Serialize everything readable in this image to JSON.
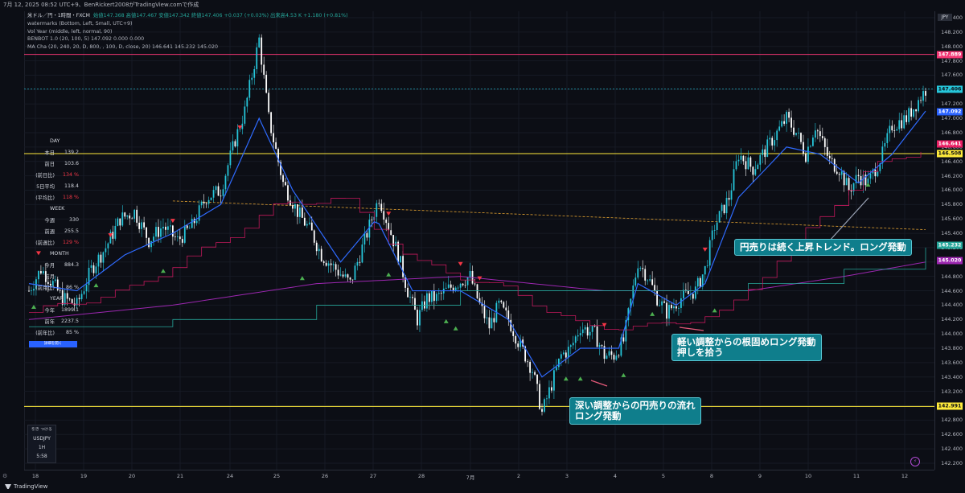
{
  "topbar": {
    "text": "7月 12, 2025 08:52 UTC+9、BenRickert2008がTradingView.comで作成"
  },
  "legend": {
    "symbol": "米ドル／円・1時間・FXCM",
    "ohlc": "始値147.368  高値147.467  安値147.342  終値147.406  +0.037 (+0.03%)  出来高4.53 K  +1.180 (+0.81%)",
    "lines": [
      "watermarks (Bottom, Left, Small, UTC+9)",
      "Vol Year (middle, left, normal, 90)",
      "BENBOT 1.0 (20, 100, 5)  147.092  0.000  0.000",
      "MA Cha (20, 240, 20, D, 800, , 100, D, close, 20)  146.641  145.232  145.020"
    ]
  },
  "stats": {
    "day_header": "DAY",
    "day": [
      {
        "label": "本日",
        "value": "139.2",
        "red": false
      },
      {
        "label": "前日",
        "value": "103.6",
        "red": false
      },
      {
        "label": "(前日比)",
        "value": "134 %",
        "red": true
      },
      {
        "label": "5日平均",
        "value": "118.4",
        "red": false
      },
      {
        "label": "(平均比)",
        "value": "118 %",
        "red": true
      }
    ],
    "week_header": "WEEK",
    "week": [
      {
        "label": "今週",
        "value": "330",
        "red": false
      },
      {
        "label": "前週",
        "value": "255.5",
        "red": false
      },
      {
        "label": "(前週比)",
        "value": "129 %",
        "red": true
      }
    ],
    "month_header": "MONTH",
    "month": [
      {
        "label": "今月",
        "value": "884.3",
        "red": false
      },
      {
        "label": "前月",
        "value": "",
        "red": false
      },
      {
        "label": "(前月比)",
        "value": "86 %",
        "red": false
      }
    ],
    "year_header": "YEAR",
    "year": [
      {
        "label": "今年",
        "value": "1899.1",
        "red": false
      },
      {
        "label": "前年",
        "value": "2237.5",
        "red": false
      },
      {
        "label": "(前年比)",
        "value": "85 %",
        "red": false
      }
    ],
    "button": "詳細を開く"
  },
  "price_axis": {
    "currency": "JPY",
    "ticks": [
      "148.400",
      "148.200",
      "148.000",
      "147.800",
      "147.600",
      "147.400",
      "147.200",
      "147.000",
      "146.800",
      "146.600",
      "146.400",
      "146.200",
      "146.000",
      "145.800",
      "145.600",
      "145.400",
      "145.200",
      "145.000",
      "144.800",
      "144.600",
      "144.400",
      "144.200",
      "144.000",
      "143.800",
      "143.600",
      "143.400",
      "143.200",
      "143.000",
      "142.800",
      "142.600",
      "142.400",
      "142.200"
    ],
    "tags": [
      {
        "value": "147.889",
        "bg": "#f23673",
        "fg": "#ffffff"
      },
      {
        "value": "147.406",
        "bg": "#26c6da",
        "fg": "#0c0e15"
      },
      {
        "value": "147.092",
        "bg": "#2962ff",
        "fg": "#ffffff"
      },
      {
        "value": "146.641",
        "bg": "#e91e63",
        "fg": "#ffffff"
      },
      {
        "value": "146.508",
        "bg": "#ffeb3b",
        "fg": "#0c0e15"
      },
      {
        "value": "145.232",
        "bg": "#26a69a",
        "fg": "#ffffff"
      },
      {
        "value": "145.020",
        "bg": "#9c27b0",
        "fg": "#ffffff"
      },
      {
        "value": "142.991",
        "bg": "#ffeb3b",
        "fg": "#0c0e15"
      }
    ]
  },
  "time_axis": [
    "18",
    "19",
    "20",
    "21",
    "24",
    "25",
    "26",
    "27",
    "28",
    "7月",
    "2",
    "3",
    "4",
    "5",
    "8",
    "9",
    "10",
    "11",
    "12"
  ],
  "annotations": [
    "円売りは続く上昇トレンド。ロング発動",
    "軽い調整からの根固めロング発動\n押しを拾う",
    "深い調整からの円売りの流れ\nロング発動"
  ],
  "ticker_box": {
    "line1": "引き つけろ",
    "symbol": "USDJPY",
    "tf": "1H",
    "time": "5:58"
  },
  "footer": {
    "brand": "TradingView"
  },
  "chart_data": {
    "type": "candlestick",
    "title": "米ドル／円・1時間・FXCM",
    "ylim": [
      142.2,
      148.45
    ],
    "x_labels": [
      "18",
      "19",
      "20",
      "21",
      "24",
      "25",
      "26",
      "27",
      "28",
      "7月",
      "2",
      "3",
      "4",
      "5",
      "8",
      "9",
      "10",
      "11",
      "12"
    ],
    "price_path": [
      [
        0,
        144.6
      ],
      [
        5,
        144.9
      ],
      [
        10,
        144.7
      ],
      [
        14,
        144.5
      ],
      [
        20,
        144.4
      ],
      [
        26,
        144.9
      ],
      [
        32,
        145.2
      ],
      [
        38,
        145.6
      ],
      [
        44,
        145.7
      ],
      [
        50,
        145.3
      ],
      [
        56,
        145.5
      ],
      [
        62,
        145.3
      ],
      [
        68,
        145.5
      ],
      [
        74,
        145.9
      ],
      [
        80,
        146.0
      ],
      [
        86,
        146.7
      ],
      [
        90,
        147.1
      ],
      [
        96,
        148.1
      ],
      [
        100,
        147.0
      ],
      [
        106,
        146.1
      ],
      [
        112,
        145.7
      ],
      [
        118,
        145.4
      ],
      [
        122,
        145.1
      ],
      [
        128,
        144.9
      ],
      [
        134,
        144.7
      ],
      [
        138,
        145.1
      ],
      [
        142,
        145.5
      ],
      [
        146,
        145.9
      ],
      [
        150,
        145.5
      ],
      [
        154,
        145.1
      ],
      [
        158,
        144.6
      ],
      [
        162,
        144.2
      ],
      [
        166,
        144.5
      ],
      [
        170,
        144.5
      ],
      [
        174,
        144.6
      ],
      [
        178,
        144.7
      ],
      [
        184,
        144.8
      ],
      [
        188,
        144.4
      ],
      [
        192,
        144.1
      ],
      [
        196,
        144.4
      ],
      [
        200,
        144.2
      ],
      [
        204,
        143.9
      ],
      [
        210,
        143.5
      ],
      [
        214,
        142.9
      ],
      [
        218,
        143.3
      ],
      [
        222,
        143.7
      ],
      [
        226,
        143.8
      ],
      [
        230,
        144.1
      ],
      [
        236,
        144.0
      ],
      [
        240,
        143.7
      ],
      [
        244,
        143.7
      ],
      [
        248,
        143.9
      ],
      [
        254,
        145.0
      ],
      [
        258,
        144.8
      ],
      [
        262,
        144.5
      ],
      [
        266,
        144.3
      ],
      [
        272,
        144.5
      ],
      [
        278,
        144.6
      ],
      [
        282,
        144.9
      ],
      [
        286,
        145.5
      ],
      [
        292,
        145.9
      ],
      [
        296,
        146.5
      ],
      [
        302,
        146.3
      ],
      [
        306,
        146.5
      ],
      [
        310,
        146.7
      ],
      [
        316,
        147.0
      ],
      [
        320,
        146.8
      ],
      [
        324,
        146.5
      ],
      [
        328,
        146.9
      ],
      [
        334,
        146.4
      ],
      [
        338,
        146.3
      ],
      [
        342,
        146.0
      ],
      [
        346,
        146.2
      ],
      [
        350,
        146.1
      ],
      [
        356,
        146.5
      ],
      [
        360,
        146.9
      ],
      [
        366,
        147.0
      ],
      [
        370,
        147.2
      ],
      [
        374,
        147.4
      ]
    ],
    "ma_fast": [
      [
        0,
        144.7
      ],
      [
        20,
        144.6
      ],
      [
        40,
        145.1
      ],
      [
        60,
        145.4
      ],
      [
        80,
        145.8
      ],
      [
        96,
        147.0
      ],
      [
        110,
        146.0
      ],
      [
        130,
        145.0
      ],
      [
        145,
        145.6
      ],
      [
        160,
        144.6
      ],
      [
        180,
        144.6
      ],
      [
        200,
        144.2
      ],
      [
        214,
        143.4
      ],
      [
        230,
        143.8
      ],
      [
        246,
        143.8
      ],
      [
        254,
        144.7
      ],
      [
        270,
        144.4
      ],
      [
        282,
        144.7
      ],
      [
        296,
        145.9
      ],
      [
        316,
        146.6
      ],
      [
        330,
        146.5
      ],
      [
        346,
        146.1
      ],
      [
        360,
        146.5
      ],
      [
        374,
        147.1
      ]
    ],
    "ma_red_step": [
      [
        0,
        144.3
      ],
      [
        40,
        144.6
      ],
      [
        80,
        145.3
      ],
      [
        104,
        145.8
      ],
      [
        130,
        145.9
      ],
      [
        160,
        145.0
      ],
      [
        200,
        144.6
      ],
      [
        230,
        144.1
      ],
      [
        260,
        144.1
      ],
      [
        290,
        144.3
      ],
      [
        320,
        145.3
      ],
      [
        350,
        146.3
      ],
      [
        374,
        146.6
      ]
    ],
    "ma_green_step": [
      [
        0,
        144.1
      ],
      [
        60,
        144.2
      ],
      [
        120,
        144.4
      ],
      [
        180,
        144.6
      ],
      [
        240,
        144.6
      ],
      [
        300,
        144.7
      ],
      [
        340,
        144.9
      ],
      [
        374,
        145.2
      ]
    ],
    "ma_purple": [
      [
        0,
        144.2
      ],
      [
        60,
        144.4
      ],
      [
        120,
        144.7
      ],
      [
        180,
        144.8
      ],
      [
        240,
        144.6
      ],
      [
        300,
        144.6
      ],
      [
        340,
        144.8
      ],
      [
        374,
        145.0
      ]
    ],
    "levels": [
      {
        "name": "resistance",
        "value": 147.889,
        "color": "#f23673"
      },
      {
        "name": "current",
        "value": 147.406,
        "color": "#26c6da"
      },
      {
        "name": "daily-line",
        "value": 146.508,
        "color": "#ffeb3b"
      },
      {
        "name": "support",
        "value": 142.991,
        "color": "#ffeb3b"
      }
    ],
    "trend_line": {
      "from": [
        60,
        145.85
      ],
      "to": [
        374,
        145.45
      ],
      "color": "#e0a030"
    },
    "buy_signals": [
      [
        2,
        144.45
      ],
      [
        28,
        144.75
      ],
      [
        56,
        144.95
      ],
      [
        114,
        144.85
      ],
      [
        150,
        144.9
      ],
      [
        174,
        144.25
      ],
      [
        178,
        144.15
      ],
      [
        224,
        143.45
      ],
      [
        230,
        143.45
      ],
      [
        248,
        143.5
      ],
      [
        260,
        144.35
      ],
      [
        286,
        144.4
      ],
      [
        350,
        146.15
      ]
    ],
    "sell_signals": [
      [
        4,
        145.05
      ],
      [
        34,
        145.3
      ],
      [
        60,
        145.5
      ],
      [
        88,
        146.8
      ],
      [
        150,
        145.6
      ],
      [
        180,
        144.9
      ],
      [
        188,
        144.7
      ],
      [
        240,
        144.05
      ],
      [
        282,
        145.1
      ]
    ]
  }
}
